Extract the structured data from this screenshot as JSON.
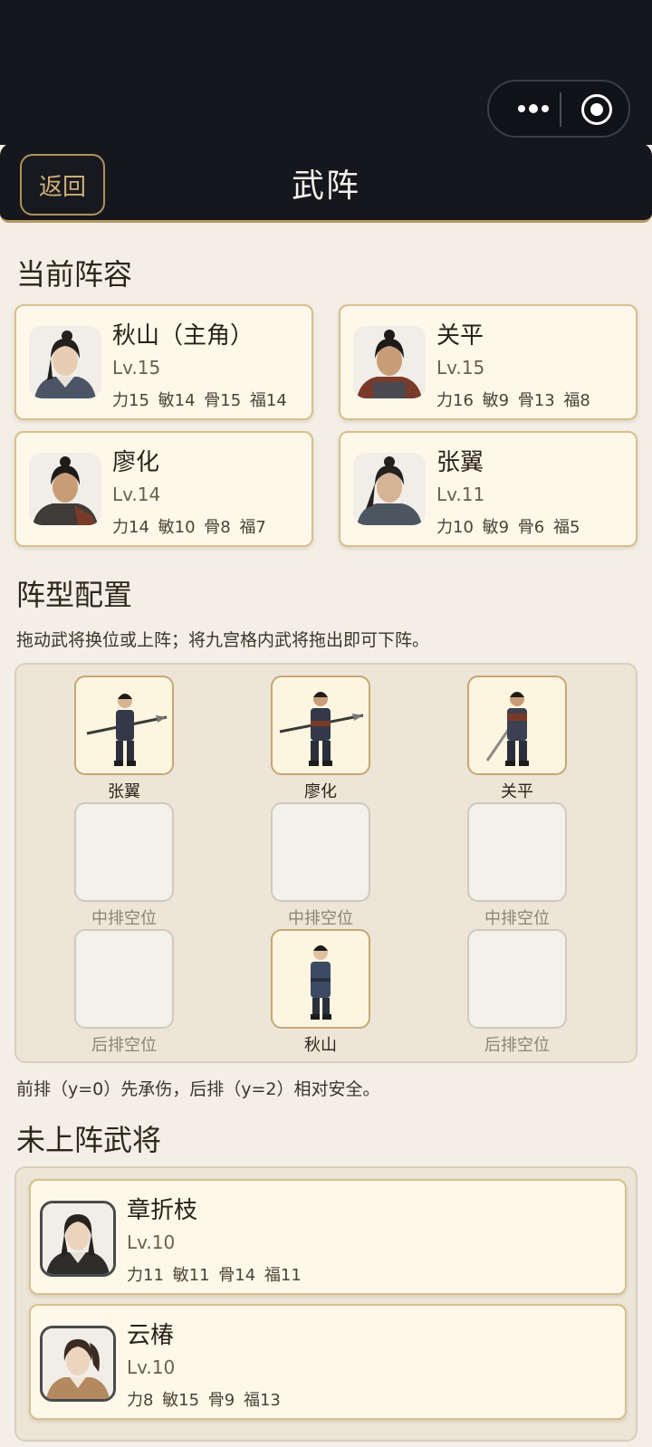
{
  "nav": {
    "back_label": "返回",
    "title": "武阵"
  },
  "sections": {
    "current": "当前阵容",
    "formation": "阵型配置",
    "formation_hint": "拖动武将换位或上阵；将九宫格内武将拖出即可下阵。",
    "formation_note": "前排（y=0）先承伤，后排（y=2）相对安全。",
    "bench": "未上阵武将"
  },
  "lineup": [
    {
      "name": "秋山（主角）",
      "level": "Lv.15",
      "stats": "力15 敏14 骨15 福14",
      "avatar": "hero-portrait-icon"
    },
    {
      "name": "关平",
      "level": "Lv.15",
      "stats": "力16 敏9 骨13 福8",
      "avatar": "hero-portrait-icon"
    },
    {
      "name": "廖化",
      "level": "Lv.14",
      "stats": "力14 敏10 骨8 福7",
      "avatar": "hero-portrait-icon"
    },
    {
      "name": "张翼",
      "level": "Lv.11",
      "stats": "力10 敏9 骨6 福5",
      "avatar": "hero-portrait-icon"
    }
  ],
  "grid": [
    {
      "label": "张翼",
      "filled": true
    },
    {
      "label": "廖化",
      "filled": true
    },
    {
      "label": "关平",
      "filled": true
    },
    {
      "label": "中排空位",
      "filled": false
    },
    {
      "label": "中排空位",
      "filled": false
    },
    {
      "label": "中排空位",
      "filled": false
    },
    {
      "label": "后排空位",
      "filled": false
    },
    {
      "label": "秋山",
      "filled": true
    },
    {
      "label": "后排空位",
      "filled": false
    }
  ],
  "bench": [
    {
      "name": "章折枝",
      "level": "Lv.10",
      "stats": "力11 敏11 骨14 福11"
    },
    {
      "name": "云椿",
      "level": "Lv.10",
      "stats": "力8 敏15 骨9 福13"
    }
  ],
  "colors": {
    "accent": "#b89561",
    "nav_bg": "#15171d",
    "page_bg": "#f3efe7",
    "card_bg": "#fdf8e9"
  }
}
